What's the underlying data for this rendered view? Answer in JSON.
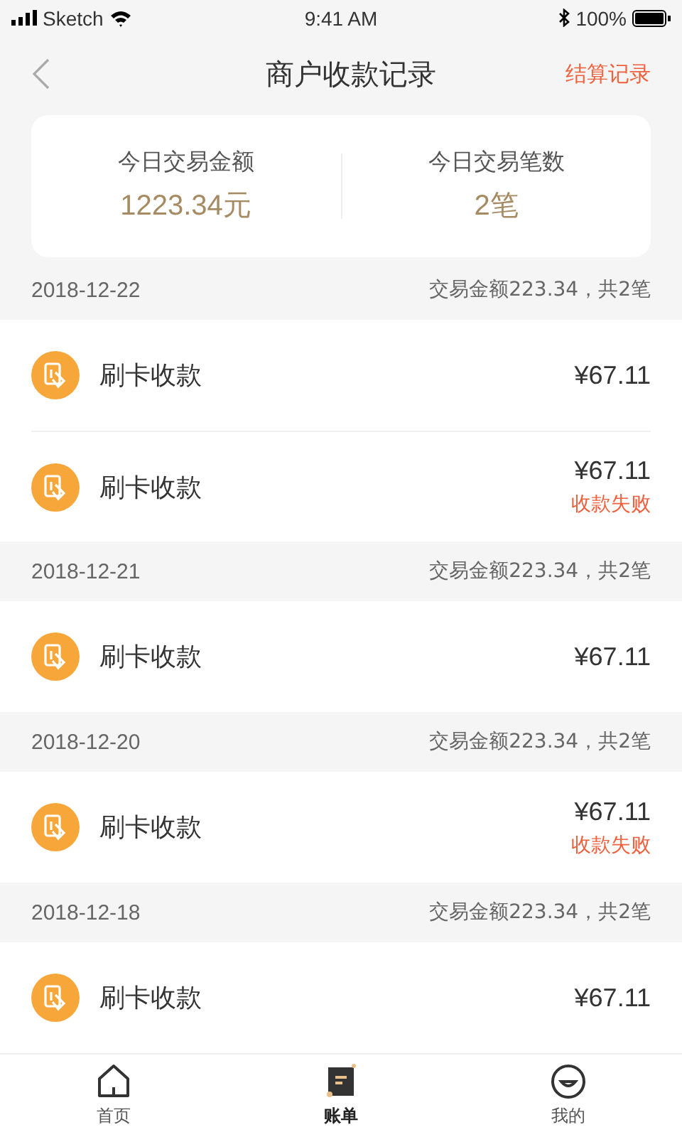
{
  "status_bar": {
    "carrier": "Sketch",
    "time": "9:41 AM",
    "battery": "100%"
  },
  "nav": {
    "title": "商户收款记录",
    "action": "结算记录"
  },
  "summary": [
    {
      "label": "今日交易金额",
      "value": "1223.34元"
    },
    {
      "label": "今日交易笔数",
      "value": "2笔"
    }
  ],
  "groups": [
    {
      "date": "2018-12-22",
      "total": "交易金额223.34，共2笔",
      "records": [
        {
          "title": "刷卡收款",
          "amount": "¥67.11"
        },
        {
          "title": "刷卡收款",
          "amount": "¥67.11",
          "status": "收款失败"
        }
      ]
    },
    {
      "date": "2018-12-21",
      "total": "交易金额223.34，共2笔",
      "records": [
        {
          "title": "刷卡收款",
          "amount": "¥67.11"
        }
      ]
    },
    {
      "date": "2018-12-20",
      "total": "交易金额223.34，共2笔",
      "records": [
        {
          "title": "刷卡收款",
          "amount": "¥67.11",
          "status": "收款失败"
        }
      ]
    },
    {
      "date": "2018-12-18",
      "total": "交易金额223.34，共2笔",
      "records": [
        {
          "title": "刷卡收款",
          "amount": "¥67.11"
        }
      ]
    }
  ],
  "tabs": [
    {
      "label": "首页",
      "selected": false
    },
    {
      "label": "账单",
      "selected": true
    },
    {
      "label": "我的",
      "selected": false
    }
  ]
}
